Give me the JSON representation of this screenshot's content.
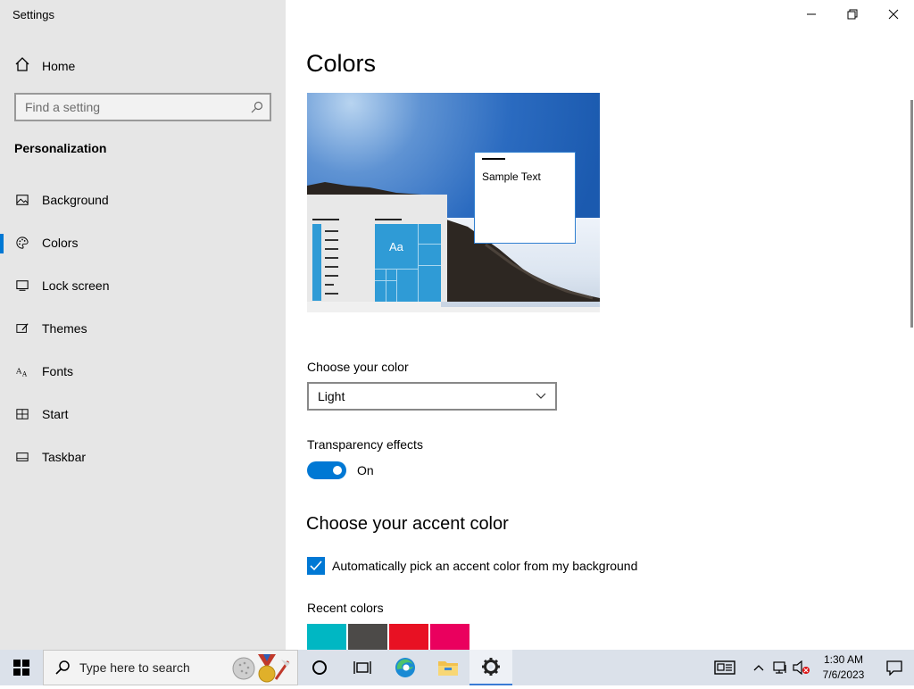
{
  "window": {
    "title": "Settings"
  },
  "sidebar": {
    "home_label": "Home",
    "search_placeholder": "Find a setting",
    "section_title": "Personalization",
    "items": [
      {
        "label": "Background",
        "icon": "picture-icon"
      },
      {
        "label": "Colors",
        "icon": "palette-icon",
        "selected": true
      },
      {
        "label": "Lock screen",
        "icon": "lock-screen-icon"
      },
      {
        "label": "Themes",
        "icon": "brush-icon"
      },
      {
        "label": "Fonts",
        "icon": "font-icon"
      },
      {
        "label": "Start",
        "icon": "start-icon"
      },
      {
        "label": "Taskbar",
        "icon": "taskbar-icon"
      }
    ]
  },
  "content": {
    "title": "Colors",
    "preview_sample_text": "Sample Text",
    "preview_tile_text": "Aa",
    "choose_color_label": "Choose your color",
    "choose_color_value": "Light",
    "transparency_label": "Transparency effects",
    "transparency_state": "On",
    "accent_heading": "Choose your accent color",
    "auto_accent_label": "Automatically pick an accent color from my background",
    "recent_colors_label": "Recent colors",
    "recent_colors": [
      "#00b7c3",
      "#4c4a48",
      "#e81123",
      "#ea005e"
    ]
  },
  "taskbar": {
    "search_placeholder": "Type here to search",
    "time": "1:30 AM",
    "date": "7/6/2023"
  },
  "colors": {
    "accent": "#0078d4",
    "sidebar_bg": "#e6e6e6",
    "taskbar_bg": "#dbe1ea"
  }
}
